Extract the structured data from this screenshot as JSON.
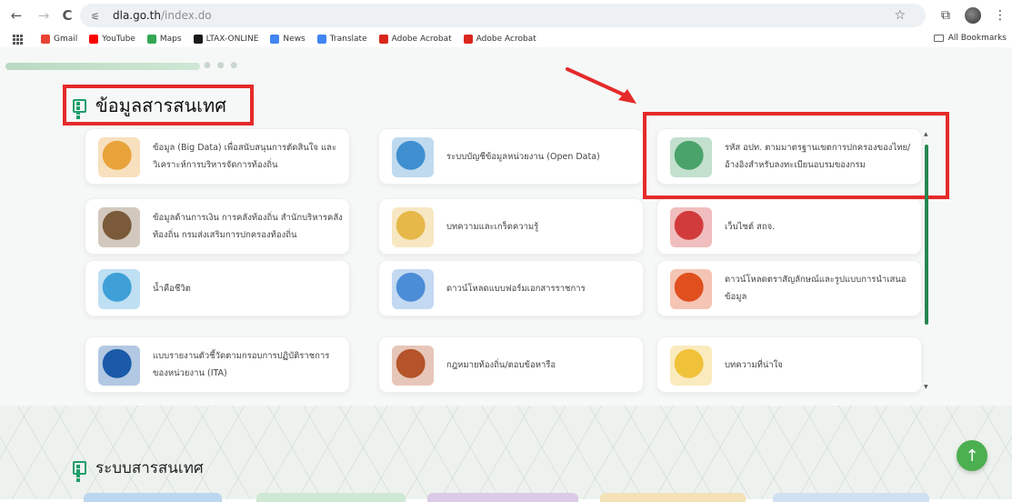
{
  "browser": {
    "url_host": "dla.go.th",
    "url_path": "/index.do",
    "nav": {
      "back": "←",
      "forward": "→",
      "reload": "C"
    },
    "bookmarks": [
      {
        "label": "Gmail",
        "color": "#ea4335",
        "icon": "google-icon"
      },
      {
        "label": "YouTube",
        "color": "#ff0000",
        "icon": "youtube-icon"
      },
      {
        "label": "Maps",
        "color": "#34a853",
        "icon": "maps-pin-icon"
      },
      {
        "label": "LTAX-ONLINE",
        "color": "#1a1a1a",
        "icon": "ltax-icon"
      },
      {
        "label": "News",
        "color": "#4285f4",
        "icon": "news-icon"
      },
      {
        "label": "Translate",
        "color": "#4285f4",
        "icon": "translate-icon"
      },
      {
        "label": "Adobe Acrobat",
        "color": "#d9261c",
        "icon": "acrobat-icon"
      },
      {
        "label": "Adobe Acrobat",
        "color": "#d9261c",
        "icon": "acrobat-icon"
      }
    ],
    "all_bookmarks": "All Bookmarks"
  },
  "section": {
    "title": "ข้อมูลสารสนเทศ"
  },
  "cards": [
    {
      "label": "ข้อมูล (Big Data) เพื่อสนับสนุนการตัดสินใจ และวิเคราะห์การบริหารจัดการท้องถิ่น",
      "icon": "big-data-icon",
      "color": "#e8a33a"
    },
    {
      "label": "ระบบบัญชีข้อมูลหน่วยงาน (Open Data)",
      "icon": "open-data-icon",
      "color": "#3f8fd0"
    },
    {
      "label": "รหัส อปท. ตามมาตรฐานเขตการปกครองของไทย/อ้างอิงสำหรับลงทะเบียนอบรมของกรม",
      "icon": "map-pin-icon",
      "color": "#4aa36b"
    },
    {
      "label": "ข้อมูลด้านการเงิน การคลังท้องถิ่น สำนักบริหารคลังท้องถิ่น กรมส่งเสริมการปกครองท้องถิ่น",
      "icon": "finance-chart-icon",
      "color": "#7a5a3a"
    },
    {
      "label": "บทความและเกร็ดความรู้",
      "icon": "knowledge-sprout-icon",
      "color": "#e6b84a"
    },
    {
      "label": "เว็บไซต์ สถจ.",
      "icon": "globe-icon",
      "color": "#d23b3b"
    },
    {
      "label": "น้ำคือชีวิต",
      "icon": "water-tap-icon",
      "color": "#3fa0d8"
    },
    {
      "label": "ดาวน์โหลดแบบฟอร์มเอกสารราชการ",
      "icon": "document-form-icon",
      "color": "#4b8dd6"
    },
    {
      "label": "ดาวน์โหลดตราสัญลักษณ์และรูปแบบการนำเสนอข้อมูล",
      "icon": "emblem-icon",
      "color": "#e0501f"
    },
    {
      "label": "แบบรายงานตัวชี้วัดตามกรอบการปฏิบัติราชการของหน่วยงาน (ITA)",
      "icon": "ita-logo-icon",
      "color": "#1a5aa8"
    },
    {
      "label": "กฎหมายท้องถิ่น/ตอบข้อหารือ",
      "icon": "gavel-icon",
      "color": "#b5532a"
    },
    {
      "label": "บทความที่น่าใจ",
      "icon": "book-bulb-icon",
      "color": "#f0c23a"
    }
  ],
  "section2": {
    "title": "ระบบสารสนเทศ"
  },
  "fab": {
    "symbol": "↑"
  },
  "colors": {
    "accent": "#1f9e6a",
    "highlight": "#e52a2a",
    "scrollbar": "#27864f"
  }
}
